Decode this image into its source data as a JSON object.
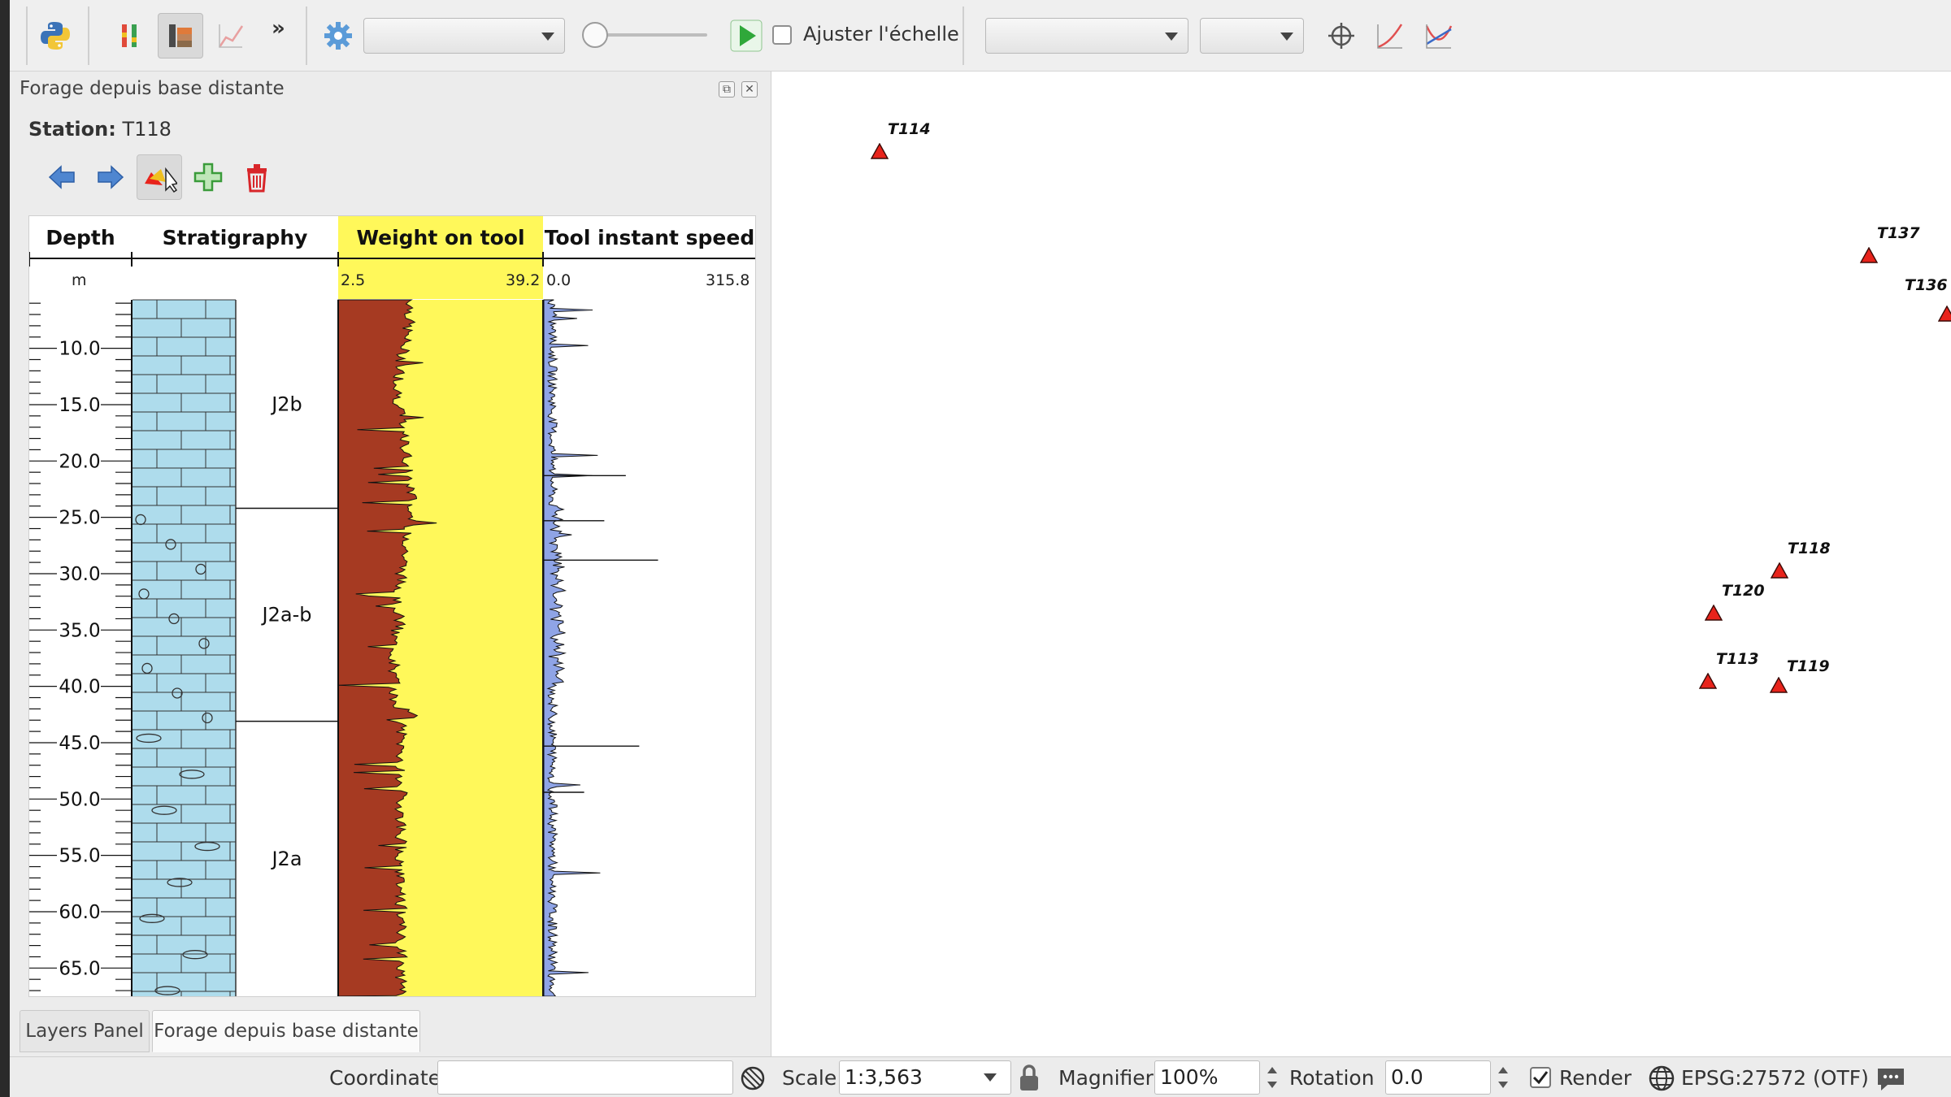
{
  "toolbar": {
    "overflow_label": "»",
    "fit_scale_label": "Ajuster l'échelle",
    "icons": [
      "python-icon",
      "plugin-bars-icon",
      "stratigraphy-icon",
      "plot-icon",
      "settings-gear-icon",
      "run-icon",
      "crosshair-icon",
      "curve-icon",
      "fit-curves-icon"
    ]
  },
  "dock": {
    "title": "Forage depuis base distante",
    "station_label": "Station:",
    "station_value": "T118"
  },
  "log": {
    "headers": {
      "depth": "Depth",
      "stratigraphy": "Stratigraphy",
      "weight": "Weight on tool",
      "speed": "Tool instant speed"
    },
    "depth_unit": "m",
    "weight_min": "2.5",
    "weight_max": "39.2",
    "speed_min": "0.0",
    "speed_max": "315.8",
    "depth_ticks": [
      "10.0",
      "15.0",
      "20.0",
      "25.0",
      "30.0",
      "35.0",
      "40.0",
      "45.0",
      "50.0",
      "55.0",
      "60.0",
      "65.0"
    ],
    "formations": [
      {
        "name": "J2b",
        "from": 5.7,
        "to": 24.2
      },
      {
        "name": "J2a-b",
        "from": 24.2,
        "to": 43.1
      },
      {
        "name": "J2a",
        "from": 43.1,
        "to": 67.5
      }
    ],
    "depth_range": [
      5.7,
      67.5
    ],
    "colors": {
      "limestone": "#aedcec",
      "weight_fill": "#a63a22",
      "weight_bg": "#fff85a",
      "speed_fill": "#8fa4e6"
    }
  },
  "map": {
    "stations": [
      "T114",
      "T137",
      "T136",
      "T118",
      "T120",
      "T113",
      "T119"
    ],
    "marker_color": "#e8231b"
  },
  "tabs": {
    "layers": "Layers Panel",
    "forage": "Forage depuis base distante"
  },
  "status": {
    "coordinate_label": "Coordinate",
    "coordinate_value": "",
    "scale_label": "Scale",
    "scale_value": "1:3,563",
    "magnifier_label": "Magnifier",
    "magnifier_value": "100%",
    "rotation_label": "Rotation",
    "rotation_value": "0.0",
    "render_label": "Render",
    "crs_label": "EPSG:27572 (OTF)"
  }
}
